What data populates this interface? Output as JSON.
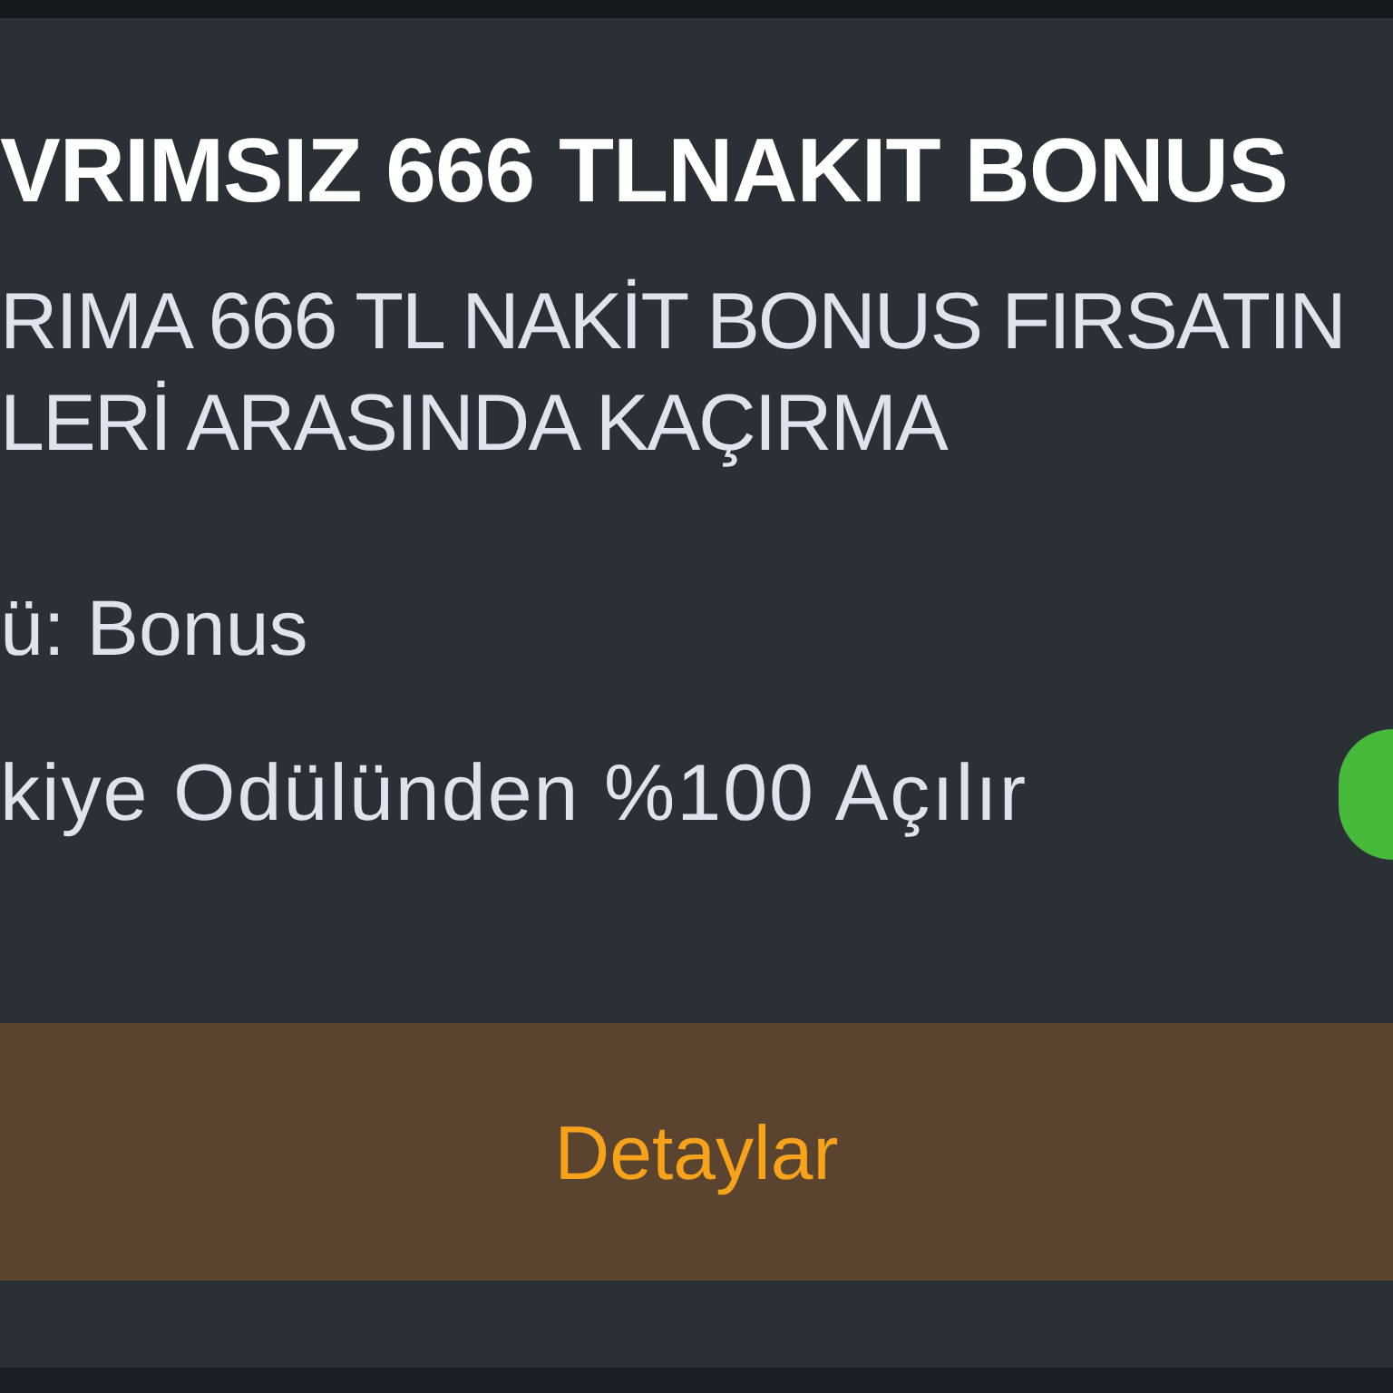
{
  "card": {
    "title": "VRIMSIZ 666 TLNAKIT BONUS",
    "subtitle_lines": [
      "RIMA 666 TL NAKİT BONUS FIRSATIN",
      "LERİ ARASINDA KAÇIRMA"
    ],
    "type_line": "ü: Bonus",
    "unlock_line": "kiye Odülünden %100 Açılır",
    "status_on": true,
    "button": "Detaylar"
  }
}
